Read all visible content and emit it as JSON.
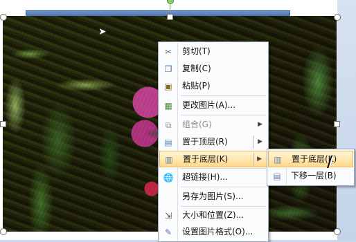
{
  "menu": {
    "items": [
      {
        "label": "剪切(T)",
        "icon": "scissors-icon",
        "disabled": false
      },
      {
        "label": "复制(C)",
        "icon": "copy-icon",
        "disabled": false
      },
      {
        "label": "粘贴(P)",
        "icon": "paste-icon",
        "disabled": false
      },
      {
        "label": "更改图片(A)...",
        "icon": "change-picture-icon",
        "disabled": false
      },
      {
        "label": "组合(G)",
        "icon": "group-icon",
        "disabled": true
      },
      {
        "label": "置于顶层(R)",
        "icon": "bring-to-front-icon",
        "disabled": false
      },
      {
        "label": "置于底层(K)",
        "icon": "send-to-back-icon",
        "disabled": false,
        "hovered": true
      },
      {
        "label": "超链接(H)...",
        "icon": "hyperlink-icon",
        "disabled": false
      },
      {
        "label": "另存为图片(S)...",
        "icon": "save-picture-icon",
        "disabled": false
      },
      {
        "label": "大小和位置(Z)...",
        "icon": "size-position-icon",
        "disabled": false
      },
      {
        "label": "设置图片格式(O)...",
        "icon": "format-picture-icon",
        "disabled": false
      }
    ]
  },
  "submenu": {
    "items": [
      {
        "label": "置于底层(K)",
        "icon": "send-to-back-icon",
        "hovered": true
      },
      {
        "label": "下移一层(B)",
        "icon": "send-backward-icon",
        "hovered": false
      }
    ]
  },
  "colors": {
    "menu_background": "#fbfcfe",
    "hover_gradient_top": "#fff6d8",
    "hover_gradient_bottom": "#ffd88a",
    "accent_blue": "#4a74b3"
  }
}
